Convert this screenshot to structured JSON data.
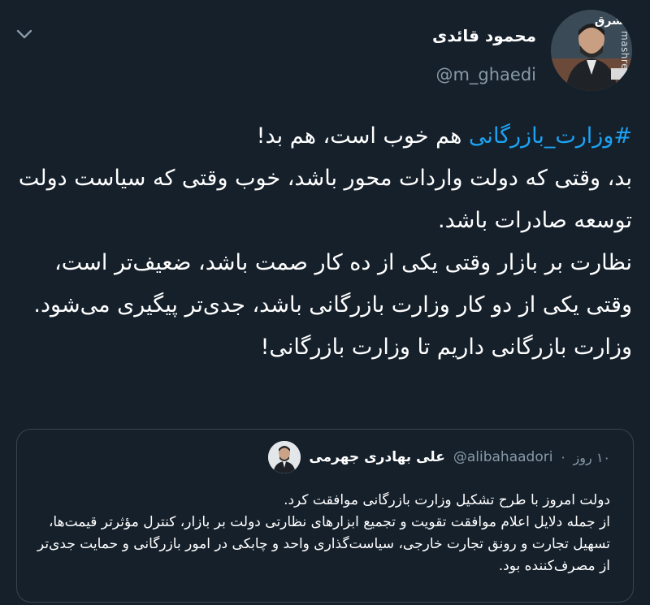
{
  "author": {
    "display_name": "محمود قائدی",
    "handle": "@m_ghaedi",
    "avatar": "author-photo",
    "watermark_logo": "مشرق",
    "watermark_site": "mashreghnews.ir"
  },
  "menu_icon": "chevron-down-icon",
  "tweet": {
    "hashtag": "#وزارت_بازرگانی",
    "lines": [
      " هم خوب است، هم بد!",
      "بد، وقتی که دولت واردات محور باشد، خوب وقتی که سیاست دولت توسعه صادرات باشد.",
      "نظارت بر بازار وقتی یکی از ده کار صمت باشد، ضعیف‌تر است، وقتی یکی از دو کار وزارت بازرگانی باشد، جدی‌تر پیگیری می‌شود.",
      "وزارت بازرگانی داریم تا وزارت بازرگانی!"
    ]
  },
  "quoted": {
    "display_name": "علی بهادری جهرمی",
    "handle": "@alibahaadori",
    "separator": "·",
    "time": "۱۰ روز",
    "lines": [
      "دولت امروز با طرح تشکیل وزارت بازرگانی موافقت کرد.",
      "از جمله دلایل اعلام موافقت تقویت و تجمیع ابزارهای نظارتی دولت بر بازار، کنترل مؤثرتر قیمت‌ها، تسهیل تجارت و رونق تجارت خارجی، سیاست‌گذاری واحد و چابکی در امور بازرگانی و حمایت جدی‌تر از مصرف‌کننده بود."
    ]
  },
  "colors": {
    "background": "#15202b",
    "link": "#1da1f2",
    "secondary_text": "#8899a6",
    "border": "#38444d"
  }
}
